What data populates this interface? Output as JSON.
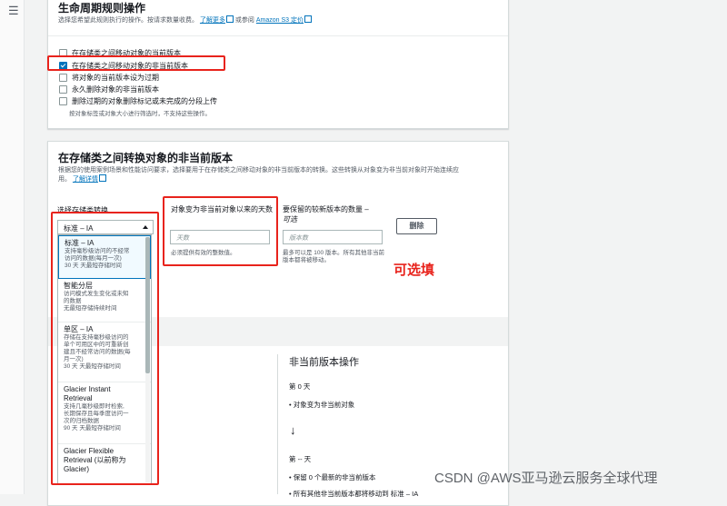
{
  "lifecycle": {
    "heading": "生命周期规则操作",
    "desc_text": "选择您希望此规则执行的操作。按请求数量收费。",
    "learn_more": "了解更多",
    "or_refer": "或参阅",
    "pricing_link": "Amazon S3 定价",
    "options": [
      {
        "label": "在存储类之间移动对象的当前版本",
        "checked": false
      },
      {
        "label": "在存储类之间移动对象的非当前版本",
        "checked": true
      },
      {
        "label": "将对象的当前版本设为过期",
        "checked": false
      },
      {
        "label": "永久删除对象的非当前版本",
        "checked": false
      },
      {
        "label": "删除过期的对象删除标记或未完成的分段上传",
        "checked": false
      }
    ],
    "note": "按对象标签或对象大小进行筛选时，不支持这些操作。"
  },
  "transition": {
    "heading": "在存储类之间转换对象的非当前版本",
    "desc_line1": "根据您的使用案例场景和性能访问要求，选择要用于在存储类之间移动对象的非当前版本的转换。这些转换从对象变为非当前对象时开始连续应",
    "desc_line2": "用。",
    "learn_pricing": "了解详情",
    "storage_label": "选择存储类转换",
    "selected": "标准 – IA",
    "days_label": "对象变为非当前对象以来的天数",
    "days_placeholder": "天数",
    "days_hint": "必须提供有效的整数值。",
    "keep_label": "要保留的较新版本的数量 –",
    "keep_optional": "可选",
    "keep_placeholder": "版本数",
    "keep_hint": "最多可以是 100 版本。所有其他非当前版本都将被移动。",
    "remove_button": "删除",
    "annotation": "可选填"
  },
  "dropdown": [
    {
      "title": "标准 – IA",
      "desc": [
        "支持毫秒级访问的不经常",
        "访问的数据(每月一次)",
        "30 天 天最短存储时间"
      ]
    },
    {
      "title": "智能分层",
      "desc": [
        "访问模式发生变化或未知",
        "的数据",
        "无最短存储持续时间"
      ]
    },
    {
      "title": "单区 – IA",
      "desc": [
        "存储在支持毫秒级访问的",
        "单个可用区中的可重新创",
        "建且不经常访问的数据(每",
        "月一次)",
        "30 天 天最短存储时间"
      ]
    },
    {
      "title": "Glacier Instant Retrieval",
      "desc": [
        "支持几毫秒级即时检索,",
        "长期保存且每季度访问一",
        "次的归档数据",
        "90 天 天最短存储时间"
      ]
    },
    {
      "title": "Glacier Flexible Retrieval (以前称为 Glacier)",
      "desc": []
    }
  ],
  "review": {
    "title": "非当前版本操作",
    "day0": "第 0 天",
    "bullet1": "对象变为非当前对象",
    "arrow": "↓",
    "day_n": "第 -- 天",
    "bullet2": "保留 0 个最新的非当前版本",
    "bullet3": "所有其他非当前版本都将移动到 标准 – IA"
  },
  "watermark": "CSDN @AWS亚马逊云服务全球代理",
  "colors": {
    "accent": "#0073bb",
    "annotation_red": "#e8231c"
  }
}
